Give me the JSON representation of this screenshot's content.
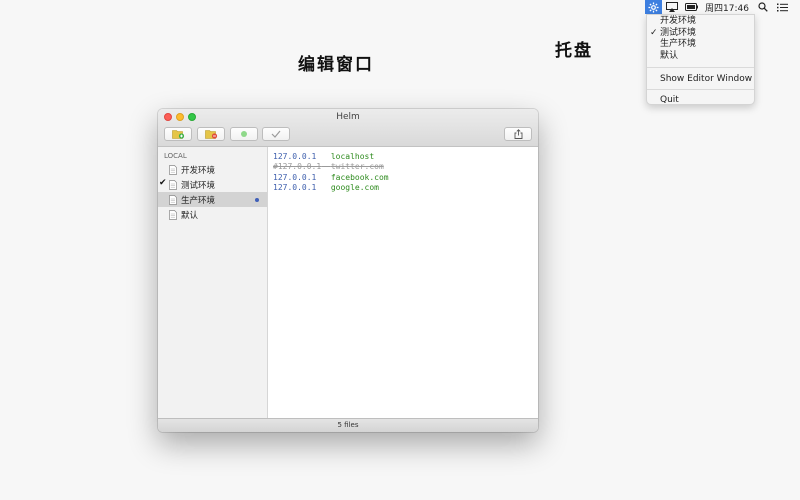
{
  "menubar": {
    "clock": "周四17:46",
    "icons": [
      "gear-icon",
      "airplay-icon",
      "battery-icon",
      "search-icon",
      "list-icon"
    ]
  },
  "tray_menu": {
    "items": [
      {
        "label": "开发环境",
        "checked": false
      },
      {
        "label": "测试环境",
        "checked": true
      },
      {
        "label": "生产环境",
        "checked": false
      },
      {
        "label": "默认",
        "checked": false
      }
    ],
    "check_mark": "✓",
    "show_editor": "Show Editor Window",
    "quit": "Quit"
  },
  "annotations": {
    "editor_window": "编辑窗口",
    "tray": "托盘"
  },
  "window": {
    "title": "Helm",
    "toolbar_icons": [
      "add-file-icon",
      "remove-file-icon",
      "enable-dot-icon",
      "checkmark-icon",
      "share-icon"
    ],
    "sidebar": {
      "header": "LOCAL",
      "items": [
        {
          "label": "开发环境",
          "checked": false,
          "selected": false,
          "dot": false
        },
        {
          "label": "测试环境",
          "checked": true,
          "selected": false,
          "dot": false
        },
        {
          "label": "生产环境",
          "checked": false,
          "selected": true,
          "dot": true
        },
        {
          "label": "默认",
          "checked": false,
          "selected": false,
          "dot": false
        }
      ],
      "check_mark": "✔"
    },
    "hosts": [
      {
        "ip": "127.0.0.1",
        "sep": "   ",
        "host": "localhost",
        "commented": false
      },
      {
        "ip": "#127.0.0.1",
        "sep": "  ",
        "host": "twitter.com",
        "commented": true
      },
      {
        "ip": "127.0.0.1",
        "sep": "   ",
        "host": "facebook.com",
        "commented": false
      },
      {
        "ip": "127.0.0.1",
        "sep": "   ",
        "host": "google.com",
        "commented": false
      }
    ],
    "status": "5 files"
  },
  "colors": {
    "accent": "#3d7fe0",
    "ip": "#3e5fad",
    "host": "#2e8b1e",
    "comment": "#9a9a9a",
    "selected_dot": "#3f5fb8"
  }
}
